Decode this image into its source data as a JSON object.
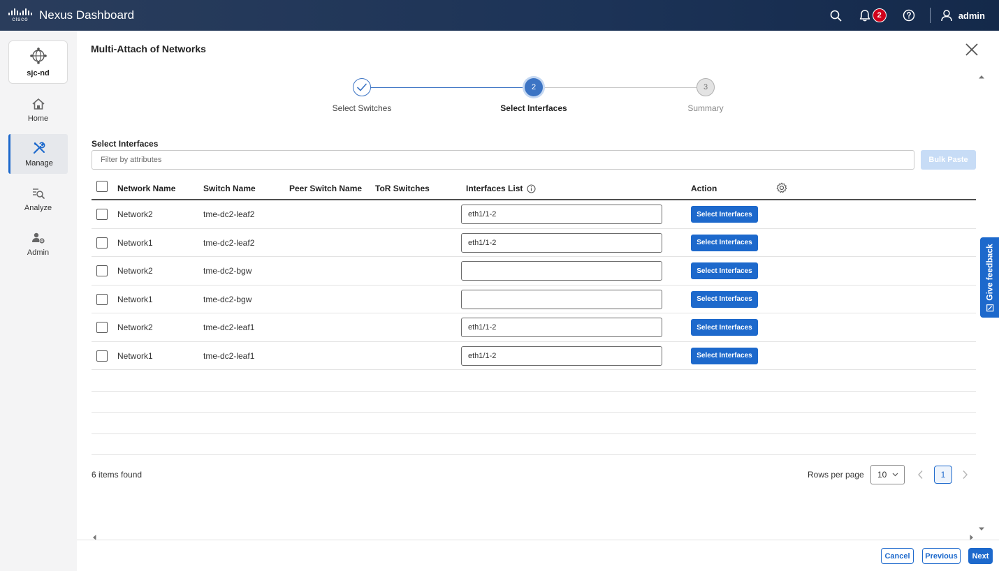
{
  "header": {
    "brand_word": "cisco",
    "app_title": "Nexus Dashboard",
    "notifications_count": "2",
    "user_name": "admin"
  },
  "sidebar": {
    "site_label": "sjc-nd",
    "items": [
      {
        "label": "Home",
        "icon": "home-icon"
      },
      {
        "label": "Manage",
        "icon": "tools-icon",
        "active": true
      },
      {
        "label": "Analyze",
        "icon": "analyze-icon"
      },
      {
        "label": "Admin",
        "icon": "admin-icon"
      }
    ]
  },
  "page": {
    "title": "Multi-Attach of Networks"
  },
  "stepper": {
    "steps": [
      {
        "label": "Select Switches",
        "number": "1",
        "state": "complete"
      },
      {
        "label": "Select Interfaces",
        "number": "2",
        "state": "current"
      },
      {
        "label": "Summary",
        "number": "3",
        "state": "upcoming"
      }
    ]
  },
  "filter": {
    "section_label": "Select Interfaces",
    "placeholder": "Filter by attributes",
    "bulk_paste_label": "Bulk Paste"
  },
  "table": {
    "columns": [
      "Network Name",
      "Switch Name",
      "Peer Switch Name",
      "ToR Switches",
      "Interfaces List",
      "Action"
    ],
    "action_label": "Select Interfaces",
    "rows": [
      {
        "network": "Network2",
        "switch": "tme-dc2-leaf2",
        "interfaces": "eth1/1-2"
      },
      {
        "network": "Network1",
        "switch": "tme-dc2-leaf2",
        "interfaces": "eth1/1-2"
      },
      {
        "network": "Network2",
        "switch": "tme-dc2-bgw",
        "interfaces": ""
      },
      {
        "network": "Network1",
        "switch": "tme-dc2-bgw",
        "interfaces": ""
      },
      {
        "network": "Network2",
        "switch": "tme-dc2-leaf1",
        "interfaces": "eth1/1-2"
      },
      {
        "network": "Network1",
        "switch": "tme-dc2-leaf1",
        "interfaces": "eth1/1-2"
      }
    ]
  },
  "pagination": {
    "items_found": "6 items found",
    "rows_per_page_label": "Rows per page",
    "rows_per_page_value": "10",
    "current_page": "1"
  },
  "actions": {
    "cancel": "Cancel",
    "previous": "Previous",
    "next": "Next"
  },
  "feedback": {
    "label": "Give feedback"
  },
  "colors": {
    "accent": "#1d69cc",
    "header_bg": "#1c3357",
    "badge": "#d0021b"
  }
}
